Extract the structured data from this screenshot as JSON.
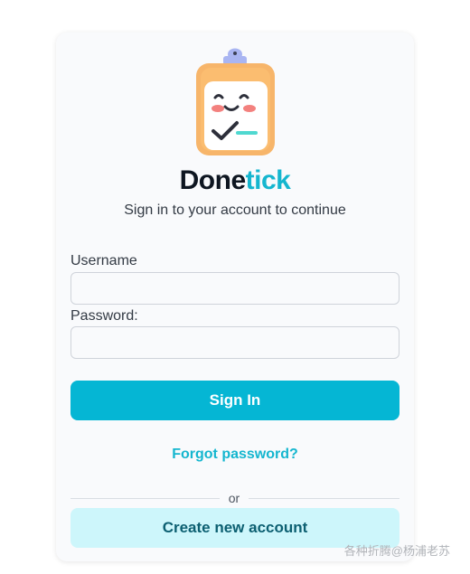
{
  "brand": {
    "name_part1": "Done",
    "name_part2": "tick",
    "accent_color": "#15b6cf"
  },
  "subtitle": "Sign in to your account to continue",
  "form": {
    "username_label": "Username",
    "username_value": "",
    "password_label": "Password:",
    "password_value": "",
    "sign_in_label": "Sign In",
    "forgot_password_label": "Forgot password?",
    "divider_text": "or",
    "create_account_label": "Create new account"
  },
  "logo_icon": "clipboard-smiley-checkmark-icon",
  "watermark": "各种折腾@杨浦老苏",
  "colors": {
    "primary_button": "#05b6d4",
    "secondary_button": "#cdf6fb",
    "secondary_button_text": "#0c5f71",
    "card_background": "#f9fafc"
  }
}
